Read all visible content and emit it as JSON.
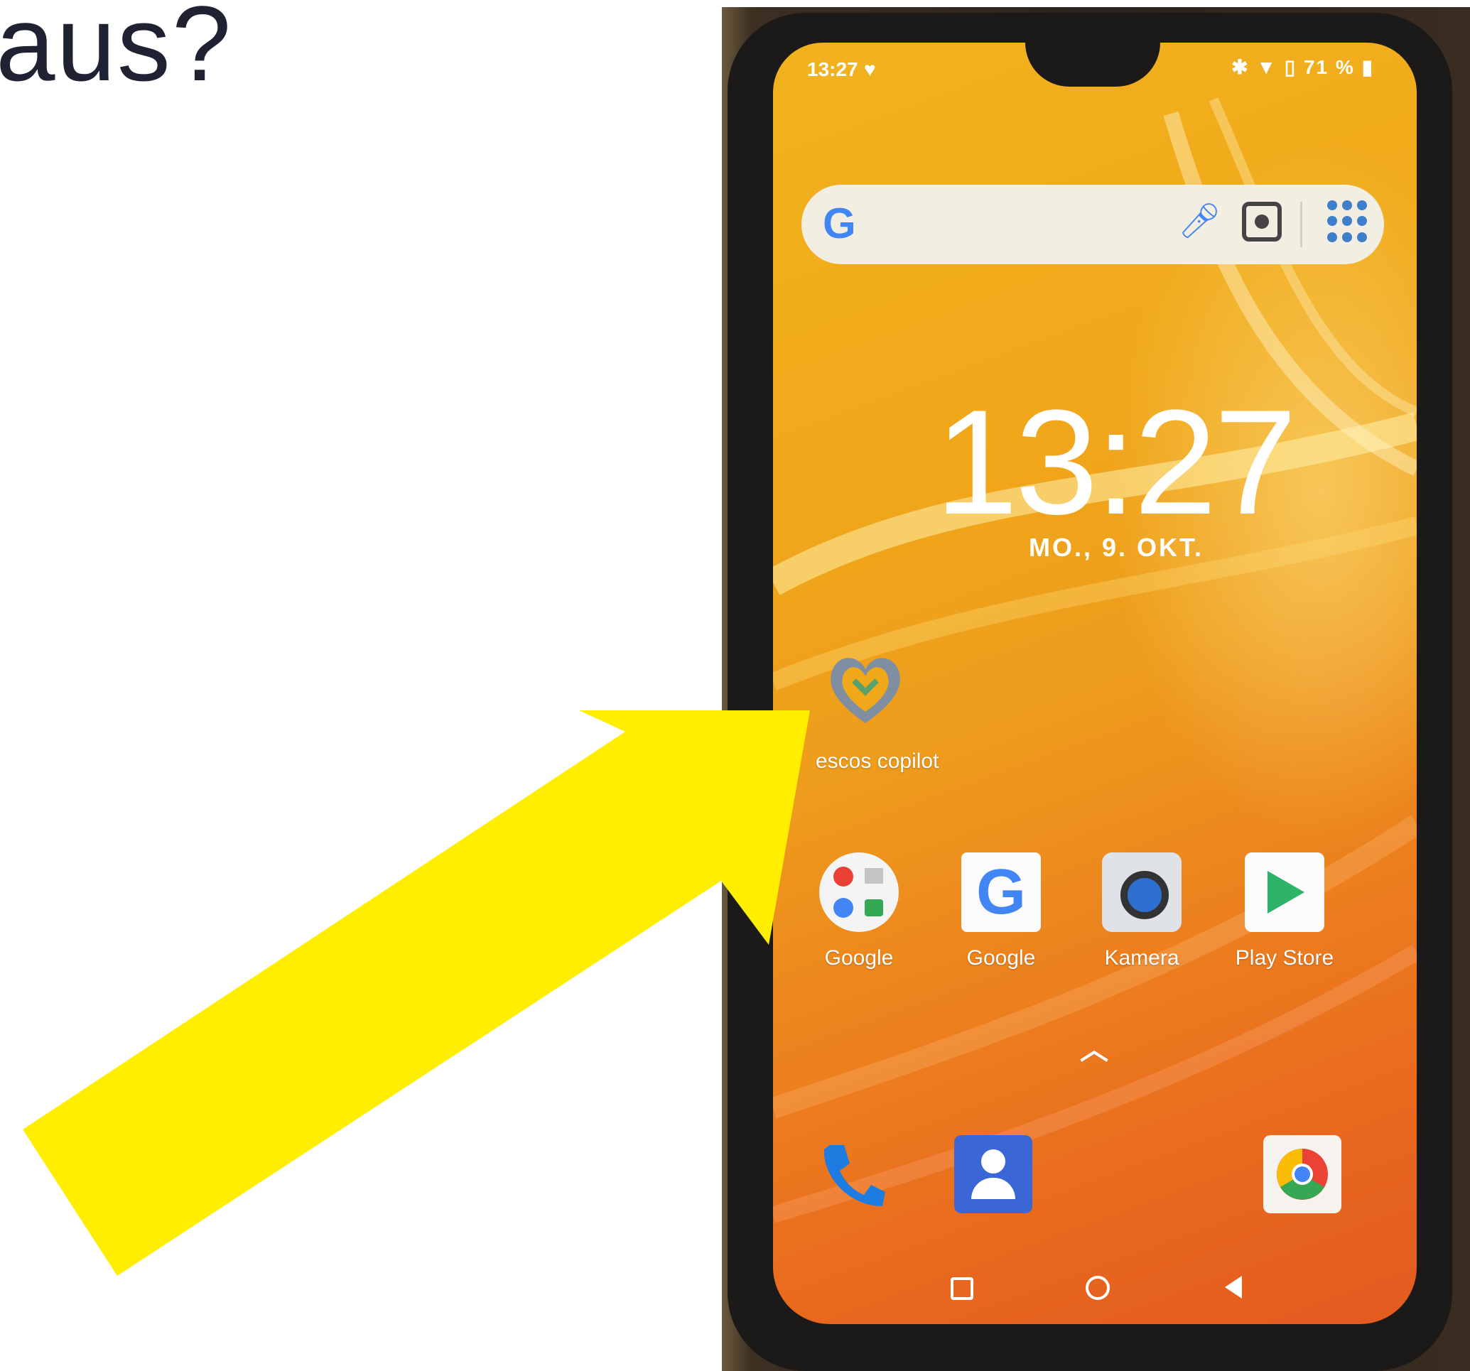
{
  "slide": {
    "heading_fragment": "aus?"
  },
  "status_bar": {
    "time": "13:27",
    "right_indicators": "71 %"
  },
  "search": {
    "logo_letter": "G"
  },
  "clock": {
    "time": "13:27",
    "date": "MO., 9. OKT."
  },
  "shortcuts": [
    {
      "label": "escos copilot",
      "icon": "heart-app-icon"
    },
    {
      "label": "Google",
      "icon": "google-folder-icon"
    },
    {
      "label": "Google",
      "icon": "google-g-icon"
    },
    {
      "label": "Kamera",
      "icon": "camera-icon"
    },
    {
      "label": "Play Store",
      "icon": "play-store-icon"
    }
  ],
  "dock": [
    {
      "icon": "phone-icon"
    },
    {
      "icon": "contacts-icon"
    },
    {
      "icon": "chrome-icon"
    }
  ],
  "nav": {
    "recent": "recent-apps-icon",
    "home": "home-icon",
    "back": "back-icon"
  },
  "colors": {
    "arrow": "#ffee00",
    "heading": "#1e2233",
    "screen_top": "#f2b21e",
    "screen_bottom": "#e25a20"
  }
}
